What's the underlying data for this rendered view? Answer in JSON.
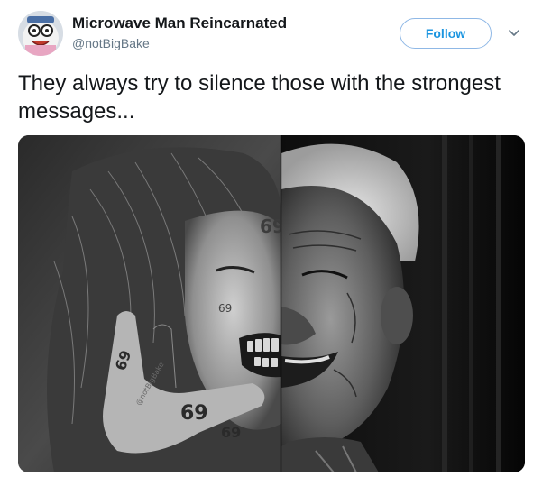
{
  "tweet": {
    "display_name": "Microwave Man Reincarnated",
    "handle": "@notBigBake",
    "follow_label": "Follow",
    "text": "They always try to silence those with the strongest messages...",
    "media": {
      "alt": "black and white split-face photo",
      "watermark": "@notBigBake"
    }
  },
  "colors": {
    "accent": "#1b95e0",
    "follow_border": "#8fb8e6",
    "text_primary": "#14171a",
    "text_secondary": "#657786"
  },
  "icons": {
    "caret": "chevron-down-icon",
    "avatar": "avatar"
  }
}
